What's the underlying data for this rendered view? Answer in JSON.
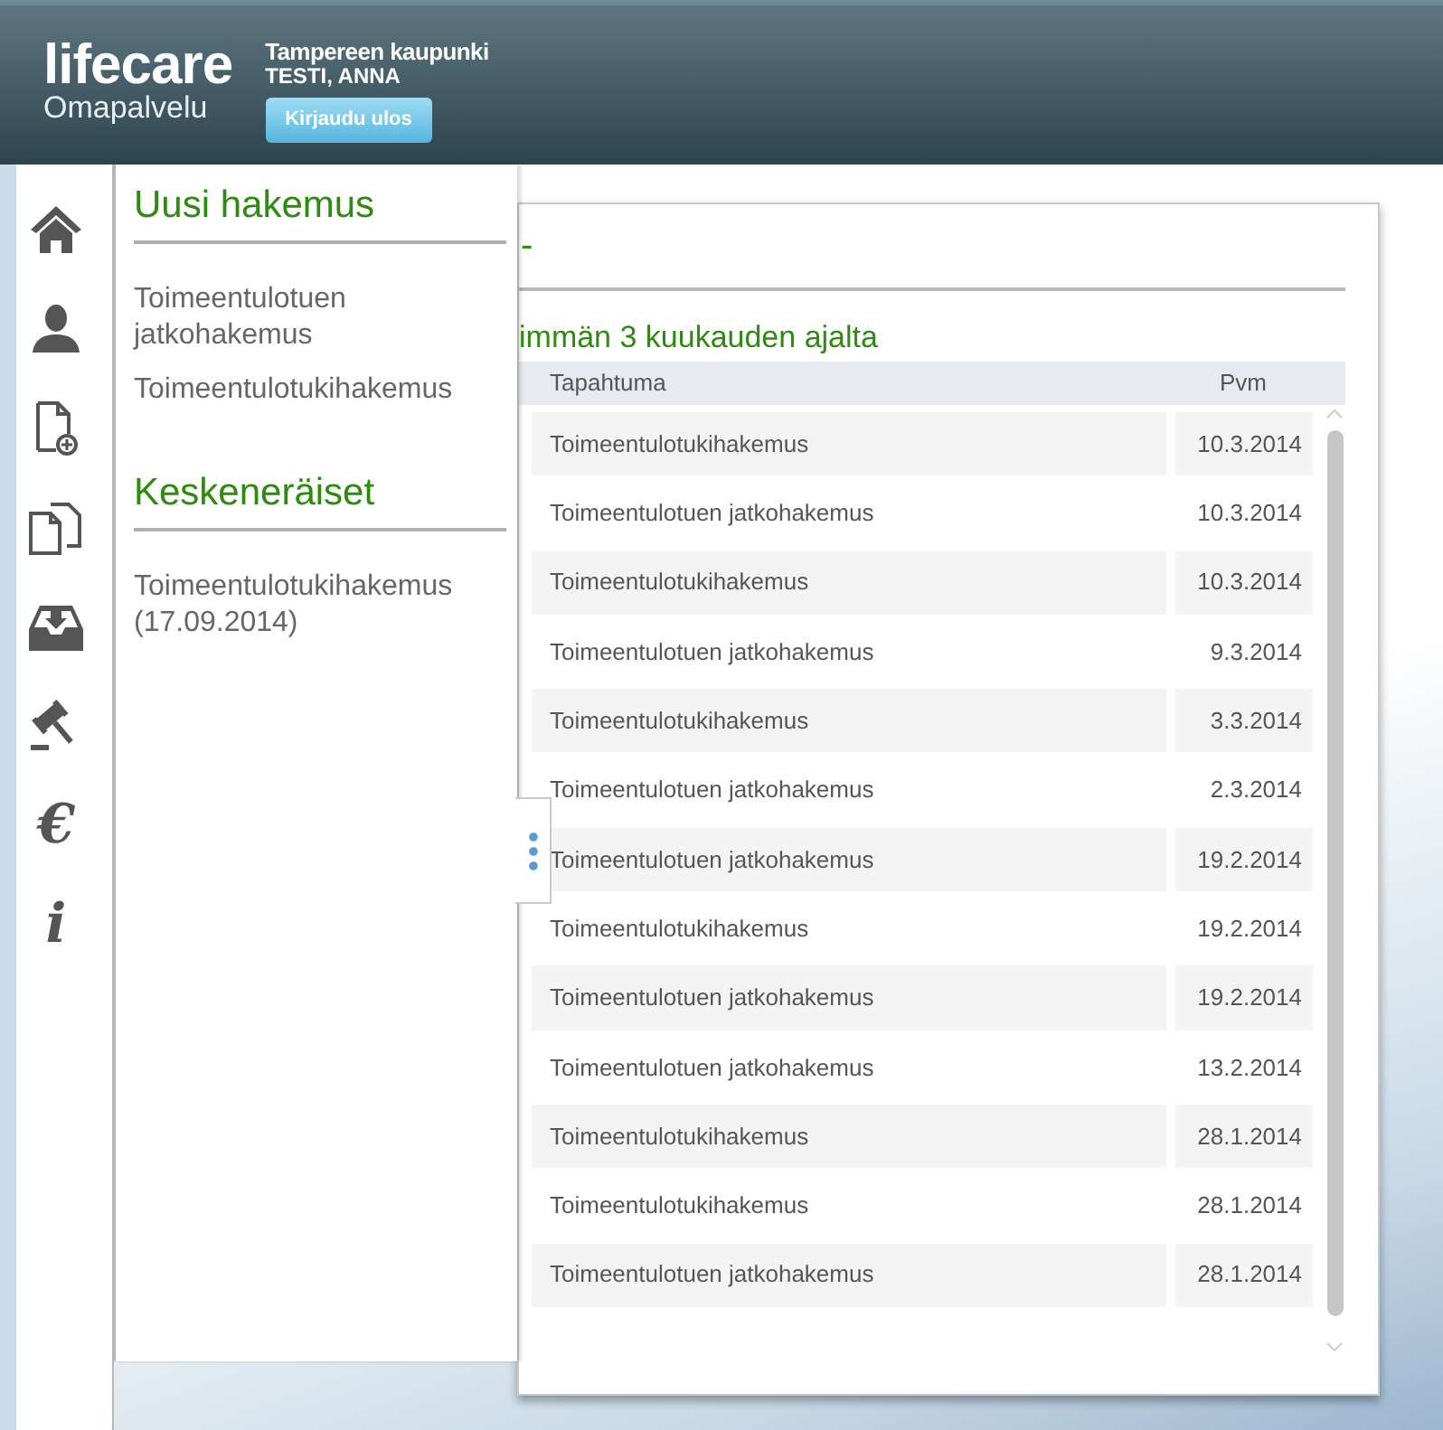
{
  "header": {
    "logo_title": "lifecare",
    "logo_subtitle": "Omapalvelu",
    "organization": "Tampereen kaupunki",
    "user": "TESTI, ANNA",
    "logout_button": "Kirjaudu ulos"
  },
  "sidebar": {
    "items": [
      {
        "kind": "home"
      },
      {
        "kind": "person"
      },
      {
        "kind": "new-document"
      },
      {
        "kind": "documents"
      },
      {
        "kind": "inbox"
      },
      {
        "kind": "gavel"
      },
      {
        "kind": "glyph",
        "glyph": "€"
      },
      {
        "kind": "glyph",
        "glyph": "i"
      }
    ]
  },
  "flyout": {
    "sections": [
      {
        "title": "Uusi hakemus",
        "items": [
          "Toimeentulotuen jatkohakemus",
          "Toimeentulotukihakemus"
        ]
      },
      {
        "title": "Keskeneräiset",
        "items": [
          "Toimeentulotukihakemus (17.09.2014)"
        ]
      }
    ]
  },
  "card": {
    "heading": "-",
    "subtitle": "immän 3 kuukauden ajalta",
    "table": {
      "columns": [
        "Tapahtuma",
        "Pvm"
      ],
      "rows": [
        [
          "Toimeentulotukihakemus",
          "10.3.2014"
        ],
        [
          "Toimeentulotuen jatkohakemus",
          "10.3.2014"
        ],
        [
          "Toimeentulotukihakemus",
          "10.3.2014"
        ],
        [
          "Toimeentulotuen jatkohakemus",
          "9.3.2014"
        ],
        [
          "Toimeentulotukihakemus",
          "3.3.2014"
        ],
        [
          "Toimeentulotuen jatkohakemus",
          "2.3.2014"
        ],
        [
          "Toimeentulotuen jatkohakemus",
          "19.2.2014"
        ],
        [
          "Toimeentulotukihakemus",
          "19.2.2014"
        ],
        [
          "Toimeentulotuen jatkohakemus",
          "19.2.2014"
        ],
        [
          "Toimeentulotuen jatkohakemus",
          "13.2.2014"
        ],
        [
          "Toimeentulotukihakemus",
          "28.1.2014"
        ],
        [
          "Toimeentulotukihakemus",
          "28.1.2014"
        ],
        [
          "Toimeentulotuen jatkohakemus",
          "28.1.2014"
        ]
      ]
    }
  }
}
